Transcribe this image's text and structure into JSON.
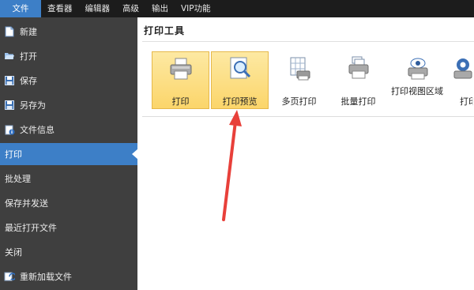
{
  "menubar": {
    "items": [
      "文件",
      "查看器",
      "编辑器",
      "高级",
      "输出",
      "VIP功能"
    ]
  },
  "sidebar": {
    "items": [
      {
        "label": "新建",
        "icon": "new-file-icon"
      },
      {
        "label": "打开",
        "icon": "folder-open-icon"
      },
      {
        "label": "保存",
        "icon": "save-icon"
      },
      {
        "label": "另存为",
        "icon": "save-as-icon"
      },
      {
        "label": "文件信息",
        "icon": "file-info-icon"
      },
      {
        "label": "打印",
        "icon": ""
      },
      {
        "label": "批处理",
        "icon": ""
      },
      {
        "label": "保存并发送",
        "icon": ""
      },
      {
        "label": "最近打开文件",
        "icon": ""
      },
      {
        "label": "关闭",
        "icon": ""
      },
      {
        "label": "重新加载文件",
        "icon": "reload-icon"
      }
    ]
  },
  "main": {
    "section_title": "打印工具",
    "tools": [
      {
        "label": "打印",
        "icon": "printer-icon"
      },
      {
        "label": "打印预览",
        "icon": "print-preview-icon"
      },
      {
        "label": "多页打印",
        "icon": "multi-page-print-icon"
      },
      {
        "label": "批量打印",
        "icon": "batch-print-icon"
      },
      {
        "label": "打印视图区域",
        "icon": "print-view-area-icon"
      },
      {
        "label": "打印",
        "icon": "print-settings-icon"
      }
    ]
  },
  "colors": {
    "menubar_bg": "#1c1c1c",
    "accent": "#3d7fc7",
    "sidebar_bg": "#3f3f3f",
    "highlight": "#fbd56a",
    "arrow": "#e8403a"
  }
}
